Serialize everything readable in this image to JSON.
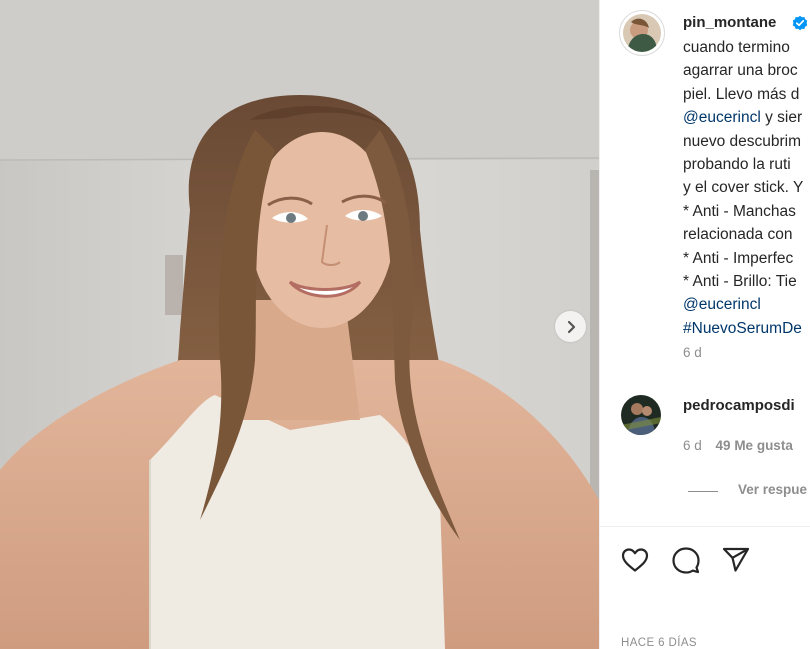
{
  "post": {
    "username": "pin_montane",
    "caption_lines": [
      "cuando termino",
      "agarrar una broc",
      "piel. Llevo más d",
      "@eucerincl y sier",
      "nuevo descubrim",
      "probando la ruti",
      "y el cover stick. Y",
      "* Anti - Manchas",
      "relacionada con",
      "* Anti - Imperfec",
      "* Anti - Brillo: Tie",
      "@eucerincl",
      "#NuevoSerumDe"
    ],
    "time": "6 d",
    "date_label": "HACE 6 DÍAS"
  },
  "comment": {
    "username": "pedrocamposdi",
    "time": "6 d",
    "likes": "49 Me gusta",
    "view_replies": "Ver respue"
  },
  "icons": {
    "next": "chevron-right-icon",
    "verified": "verified-badge-icon",
    "like": "heart-icon",
    "comment": "comment-icon",
    "share": "paper-plane-icon"
  },
  "colors": {
    "verified": "#0095f6",
    "link": "#00376b",
    "muted": "#8e8e8e"
  }
}
